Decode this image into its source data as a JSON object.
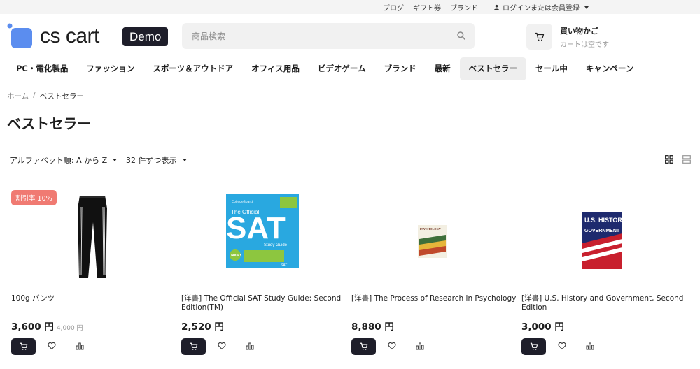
{
  "topbar": {
    "links": [
      "ブログ",
      "ギフト券",
      "ブランド"
    ],
    "login": "ログインまたは会員登録"
  },
  "header": {
    "logo_text": "cs cart",
    "logo_badge": "Demo",
    "search_placeholder": "商品検索",
    "cart_title": "買い物かご",
    "cart_status": "カートは空です"
  },
  "nav": {
    "items": [
      "PC・電化製品",
      "ファッション",
      "スポーツ＆アウトドア",
      "オフィス用品",
      "ビデオゲーム",
      "ブランド",
      "最新",
      "ベストセラー",
      "セール中",
      "キャンペーン"
    ],
    "active_index": 7
  },
  "breadcrumb": {
    "home": "ホーム",
    "separator": "/",
    "current": "ベストセラー"
  },
  "page_title": "ベストセラー",
  "sorting": {
    "sort_label": "アルファベット順: A から Z",
    "per_page_label": "32 件ずつ表示"
  },
  "colors": {
    "accent_dark": "#1e1e2a",
    "discount_badge": "#f07a72",
    "logo_blue": "#5b8def"
  },
  "products": [
    {
      "name": "100g パンツ",
      "price": "3,600 円",
      "old_price": "4,000 円",
      "badge": "割引率 10%"
    },
    {
      "name": "[洋書] The Official SAT Study Guide: Second Edition(TM)",
      "price": "2,520 円",
      "old_price": "",
      "badge": ""
    },
    {
      "name": "[洋書] The Process of Research in Psychology",
      "price": "8,880 円",
      "old_price": "",
      "badge": ""
    },
    {
      "name": "[洋書] U.S. History and Government, Second Edition",
      "price": "3,000 円",
      "old_price": "",
      "badge": ""
    }
  ],
  "book_covers": {
    "sat_brand": "CollegeBoard",
    "sat_the_official": "The Official",
    "sat_big": "SAT",
    "sat_sub": "Study Guide",
    "sat_new": "New!",
    "sat_footer": "SAT",
    "psych_title": "PSYCHOLOGY",
    "history_line1": "U.S. HISTORY",
    "history_line2": "GOVERNMENT"
  }
}
